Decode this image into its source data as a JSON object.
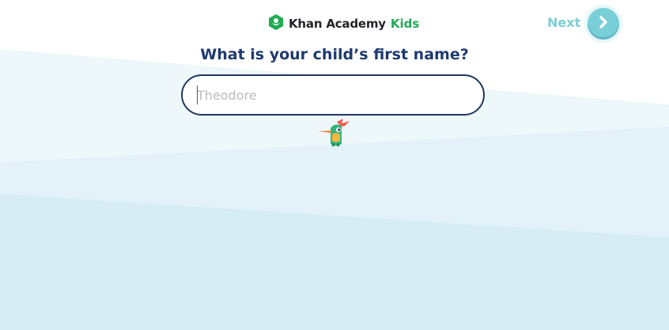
{
  "app": {
    "brand_name": "Khan Academy",
    "brand_kids": "Kids",
    "logo_icon": "hexagon-leaf-icon"
  },
  "nav": {
    "next_label": "Next",
    "next_icon": "chevron-right-icon"
  },
  "form": {
    "question": "What is your child’s first name?",
    "name_value": "",
    "name_placeholder": "Theodore"
  },
  "mascot": {
    "icon": "bird-mascot-icon"
  },
  "colors": {
    "brand_green": "#1fab54",
    "heading_navy": "#1e3a6e",
    "next_teal": "#79cfd8",
    "background_light": "#e6f4f8",
    "background_mid": "#d9eef6"
  }
}
